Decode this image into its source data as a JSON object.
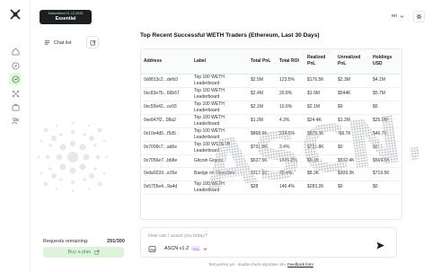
{
  "plan": {
    "date": "Subscribed 01.12.2025",
    "name": "Essential"
  },
  "sidebar": {
    "chat_list_label": "Chat list"
  },
  "rail": {
    "icons": [
      "logo-icon",
      "home-icon",
      "compass-icon",
      "chart-icon",
      "network-icon",
      "briefcase-icon",
      "users-icon"
    ]
  },
  "header": {
    "language": "en"
  },
  "requests": {
    "label": "Requests remaining:",
    "count": "291/300"
  },
  "buy_plan_label": "Buy a plan",
  "main": {
    "title": "Top Recent Successful WETH Traders (Ethereum, Last 30 Days)",
    "columns": [
      "Address",
      "Label",
      "Total PnL",
      "Total ROI",
      "Realized PnL",
      "Unrealized PnL",
      "Holdings USD"
    ],
    "rows": [
      [
        "0x8813c2...defc0",
        "Top 100 WETH Leaderboard",
        "$2.5M",
        "123.5%",
        "$176.5K",
        "$2.3M",
        "$4.1M"
      ],
      [
        "0xc83e7b...66b57",
        "Top 100 WETH Leaderboard",
        "$2.4M",
        "20.8%",
        "$1.9M",
        "$544K",
        "$5.7M"
      ],
      [
        "0xc55b42...ce93",
        "Top 100 WETH Leaderboard",
        "$2.1M",
        "10.6%",
        "$2.1M",
        "$0",
        "$0"
      ],
      [
        "0xe847f2...08a2",
        "Top 100 WETH Leaderboard",
        "$1.2M",
        "4.3%",
        "$24.4K",
        "$1.2M",
        "$25.9M"
      ],
      [
        "0x10e4d5...f5d5",
        "Top 100 WETH Leaderboard",
        "$868.6K",
        "214.5%",
        "$875.3K",
        "-$6.7K",
        "$46.7K"
      ],
      [
        "0x7099c7...ad6e",
        "Top 100 WSTETH Leaderboard",
        "$731.8K",
        "3.4%",
        "$731.8K",
        "$0",
        "$0"
      ],
      [
        "0x7056e7...bb8e",
        "Gitcoin Grants",
        "$537.5K",
        "1435.2%",
        "$5.1K",
        "$532.4K",
        "$569.5K"
      ],
      [
        "0xda022d...e35e",
        "Baelge on OpenSea",
        "$317.6K",
        "76.4%",
        "$8.3K",
        "$309.3K",
        "$719.5K"
      ],
      [
        "0x5755e4...9a4d",
        "Top 100 WETH Leaderboard",
        "$28",
        "146.4%",
        "$283.2K",
        "$0",
        "$0"
      ]
    ]
  },
  "chat": {
    "placeholder": "How can I assist you today?",
    "model": "ASCN v1.2",
    "pro_badge": "Pro"
  },
  "footer": {
    "text": "Test perfect yet · double-check important info.",
    "link": "Feedback form"
  },
  "watermark_text": "ASCN.AI",
  "colors": {
    "accent": "#3aa14b",
    "accent_bg": "#dff2dc",
    "plan_bg": "#1c1f22",
    "pro": "#8b5cf6"
  }
}
